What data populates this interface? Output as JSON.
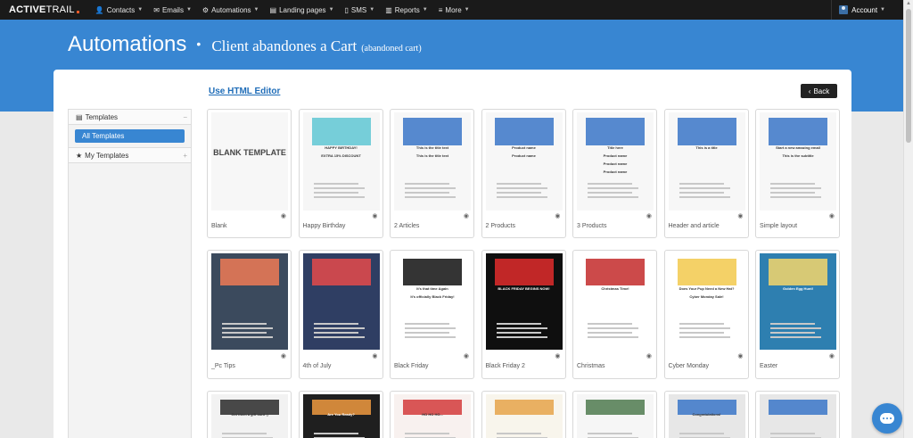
{
  "nav": {
    "logo_bold": "ACTIVE",
    "logo_light": "TRAIL",
    "items": [
      {
        "icon": "user-icon",
        "glyph": "👤",
        "label": "Contacts"
      },
      {
        "icon": "envelope-icon",
        "glyph": "✉",
        "label": "Emails"
      },
      {
        "icon": "automation-icon",
        "glyph": "⚙",
        "label": "Automations"
      },
      {
        "icon": "file-icon",
        "glyph": "▤",
        "label": "Landing pages"
      },
      {
        "icon": "mobile-icon",
        "glyph": "▯",
        "label": "SMS"
      },
      {
        "icon": "chart-icon",
        "glyph": "▥",
        "label": "Reports"
      },
      {
        "icon": "menu-icon",
        "glyph": "≡",
        "label": "More"
      }
    ],
    "account_label": "Account"
  },
  "header": {
    "title": "Automations",
    "separator": "•",
    "subtitle": "Client abandones a Cart",
    "note": "(abandoned cart)"
  },
  "panel": {
    "html_editor_link": "Use HTML Editor",
    "back_label": "Back"
  },
  "sidebar": {
    "templates_label": "Templates",
    "templates_toggle": "−",
    "all_templates_label": "All Templates",
    "my_templates_label": "My Templates",
    "my_templates_toggle": "+"
  },
  "templates": [
    {
      "name": "Blank",
      "thumb_text": "BLANK TEMPLATE"
    },
    {
      "name": "Happy Birthday",
      "thumb_texts": [
        "HAPPY BIRTHDAY!",
        "EXTRA 15% DISCOUNT"
      ]
    },
    {
      "name": "2 Articles",
      "thumb_texts": [
        "This is the title text",
        "This is the title text"
      ]
    },
    {
      "name": "2 Products",
      "thumb_texts": [
        "Product name",
        "Product name"
      ]
    },
    {
      "name": "3 Products",
      "thumb_texts": [
        "Title here",
        "Product name",
        "Product name",
        "Product name"
      ]
    },
    {
      "name": "Header and article",
      "thumb_texts": [
        "This is a title"
      ]
    },
    {
      "name": "Simple layout",
      "thumb_texts": [
        "Start a new amazing email",
        "This is the subtitle"
      ]
    },
    {
      "name": "_Pc Tips"
    },
    {
      "name": "4th of July"
    },
    {
      "name": "Black Friday",
      "thumb_texts": [
        "It's that time Again",
        "It's officially Black Friday!"
      ]
    },
    {
      "name": "Black Friday 2",
      "thumb_texts": [
        "BLACK FRIDAY BEGINS NOW!"
      ]
    },
    {
      "name": "Christmas",
      "thumb_texts": [
        "Christmas Time!"
      ]
    },
    {
      "name": "Cyber Monday",
      "thumb_texts": [
        "Does Your Pup Need a New Hat?",
        "Cyber Monday Sale!"
      ]
    },
    {
      "name": "Easter",
      "thumb_texts": [
        "Golden Egg Hunt!"
      ]
    },
    {
      "name": "",
      "thumb_texts": [
        "Get them a gift card :)"
      ]
    },
    {
      "name": "",
      "thumb_texts": [
        "Are You Ready?"
      ]
    },
    {
      "name": "",
      "thumb_texts": [
        "HO HO HO..."
      ]
    },
    {
      "name": ""
    },
    {
      "name": ""
    },
    {
      "name": "",
      "thumb_texts": [
        "Congratulations!"
      ]
    },
    {
      "name": ""
    }
  ],
  "colors": {
    "brand_blue": "#3886d2",
    "nav_dark": "#1a1a1a",
    "logo_accent": "#ea5a2a"
  },
  "icons": {
    "eye": "eye-icon",
    "back": "chevron-left-icon",
    "templates": "file-icon",
    "my_templates": "star-icon",
    "chat": "chat-icon"
  }
}
